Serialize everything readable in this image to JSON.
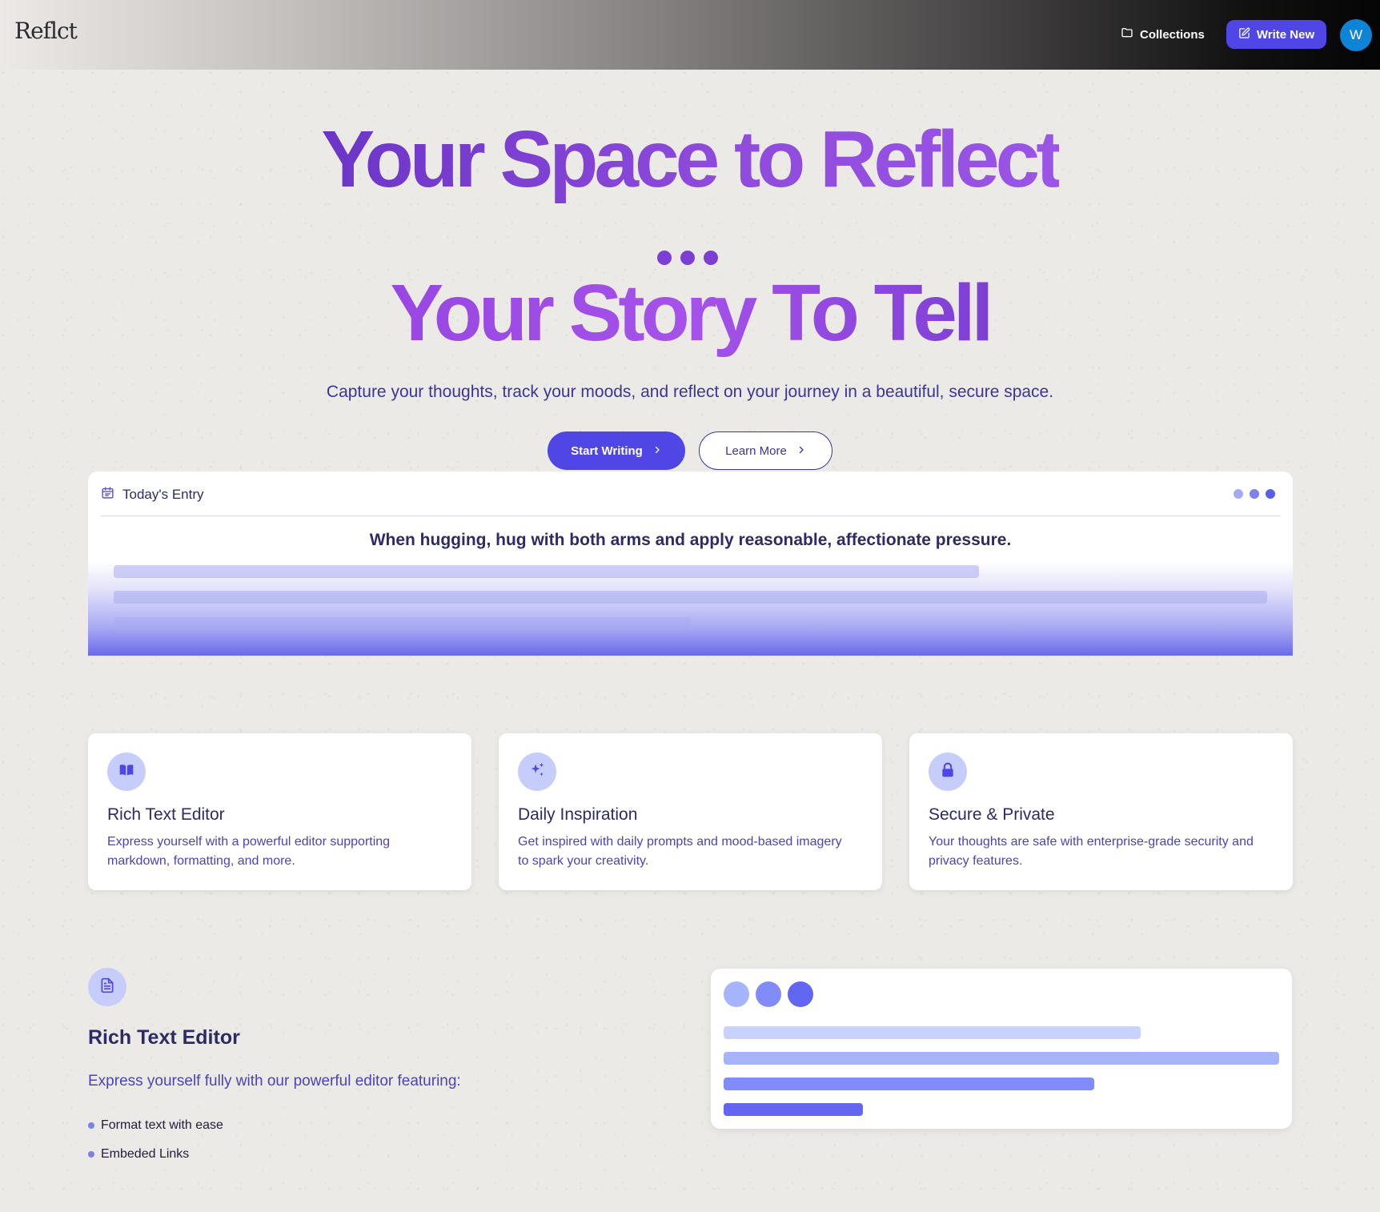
{
  "header": {
    "logo_text": "Reflct",
    "collections_label": "Collections",
    "write_new_label": "Write New",
    "avatar_initial": "W"
  },
  "hero": {
    "line1": "Your Space to Reflect",
    "line2": "Your Story To Tell",
    "subtitle": "Capture your thoughts, track your moods, and reflect on your journey in a beautiful, secure space.",
    "start_label": "Start Writing",
    "learn_label": "Learn More"
  },
  "entry": {
    "title": "Today's Entry",
    "quote": "When hugging, hug with both arms and apply reasonable, affectionate pressure.",
    "dot_colors": [
      "#a5a9f3",
      "#7d81ec",
      "#5b5fe4"
    ]
  },
  "features": [
    {
      "title": "Rich Text Editor",
      "description": "Express yourself with a powerful editor supporting markdown, formatting, and more.",
      "icon": "book-open-icon"
    },
    {
      "title": "Daily Inspiration",
      "description": "Get inspired with daily prompts and mood-based imagery to spark your creativity.",
      "icon": "sparkles-icon"
    },
    {
      "title": "Secure & Private",
      "description": "Your thoughts are safe with enterprise-grade security and privacy features.",
      "icon": "lock-icon"
    }
  ],
  "rich_text": {
    "icon": "document-icon",
    "title": "Rich Text Editor",
    "description": "Express yourself fully with our powerful editor featuring:",
    "items": [
      "Format text with ease",
      "Embeded Links"
    ]
  },
  "preview": {
    "dot_colors": [
      "#a5b4fc",
      "#818cf8",
      "#6366f1"
    ],
    "bar_colors": [
      "#c7d2fe",
      "#a5b4fc",
      "#818cf8",
      "#6366f1"
    ]
  },
  "colors": {
    "accent": "#4f46e5",
    "heading": "#2e2a66",
    "body_text": "#4b44b6",
    "hero_purple": "#8b45db",
    "avatar_blue": "#0d84d6"
  }
}
